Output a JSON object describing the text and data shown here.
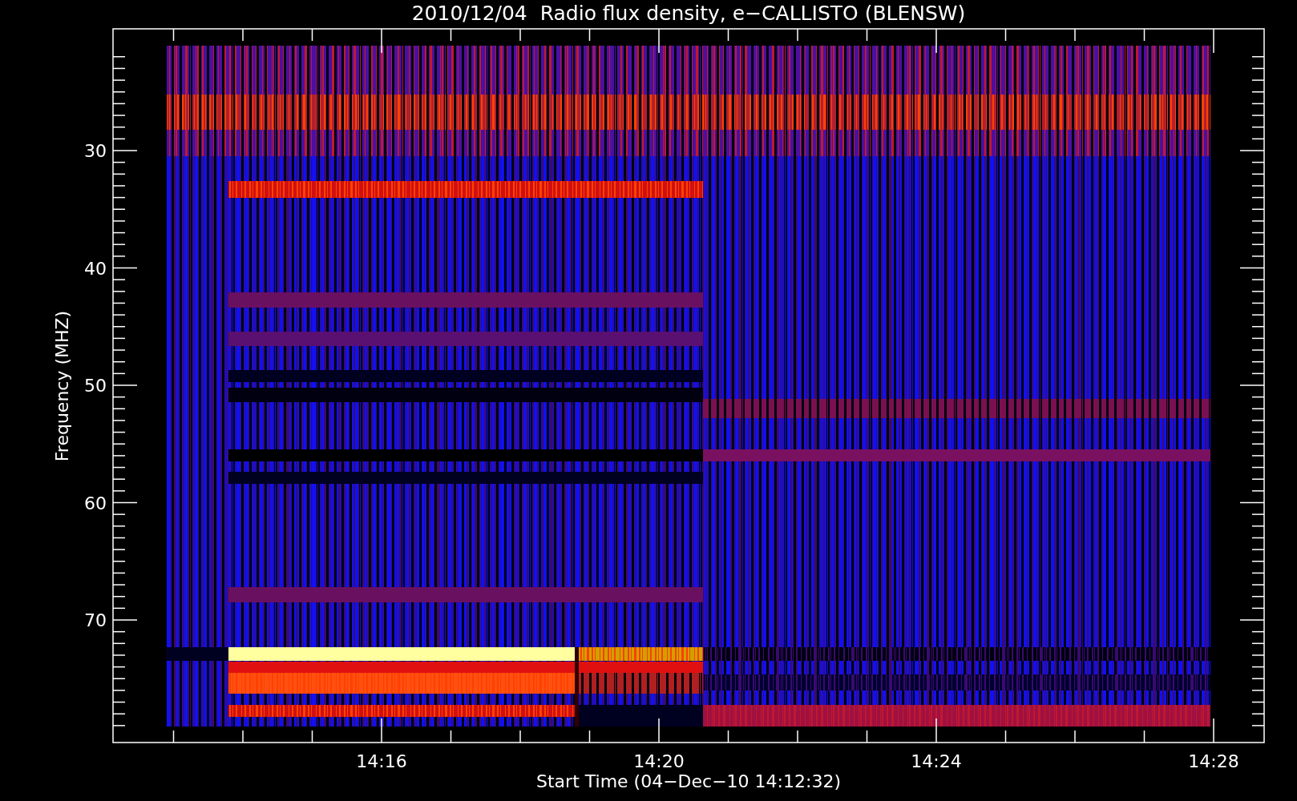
{
  "plot": {
    "title": "2010/12/04  Radio flux density, e−CALLISTO (BLENSW)",
    "ylabel": "Frequency (MHZ)",
    "xlabel": "Start Time (04−Dec−10 14:12:32)",
    "yticks": [
      "30",
      "40",
      "50",
      "60",
      "70"
    ],
    "xticks": [
      "14:16",
      "14:20",
      "14:24",
      "14:28"
    ]
  }
}
